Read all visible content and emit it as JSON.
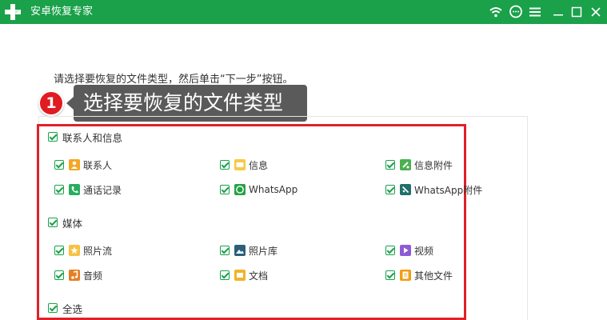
{
  "app": {
    "title": "安卓恢复专家"
  },
  "instruction": "请选择要恢复的文件类型，然后单击“下一步”按钮。",
  "callout": {
    "step": "1",
    "text": "选择要恢复的文件类型"
  },
  "sections": [
    {
      "label": "联系人和信息",
      "items": [
        {
          "label": "联系人",
          "icon": "contact-icon",
          "color": "#f5a623"
        },
        {
          "label": "信息",
          "icon": "message-icon",
          "color": "#f7c948"
        },
        {
          "label": "信息附件",
          "icon": "attachment-icon",
          "color": "#4caf50"
        },
        {
          "label": "通话记录",
          "icon": "phone-icon",
          "color": "#27ae60"
        },
        {
          "label": "WhatsApp",
          "icon": "whatsapp-icon",
          "color": "#25a244"
        },
        {
          "label": "WhatsApp附件",
          "icon": "whatsapp-attachment-icon",
          "color": "#1f6f6a"
        }
      ]
    },
    {
      "label": "媒体",
      "items": [
        {
          "label": "照片流",
          "icon": "photo-stream-icon",
          "color": "#f5c242"
        },
        {
          "label": "照片库",
          "icon": "photo-library-icon",
          "color": "#2c5f7c"
        },
        {
          "label": "视频",
          "icon": "video-icon",
          "color": "#8e5bd6"
        },
        {
          "label": "音频",
          "icon": "audio-icon",
          "color": "#e67e22"
        },
        {
          "label": "文档",
          "icon": "document-icon",
          "color": "#f0b429"
        },
        {
          "label": "其他文件",
          "icon": "other-files-icon",
          "color": "#f39c12"
        }
      ]
    }
  ],
  "select_all": {
    "label": "全选"
  },
  "colors": {
    "titlebar": "#1aa14a",
    "accent": "#1aa14a",
    "highlight": "#e0202a",
    "callout": "#5a5a5a"
  }
}
